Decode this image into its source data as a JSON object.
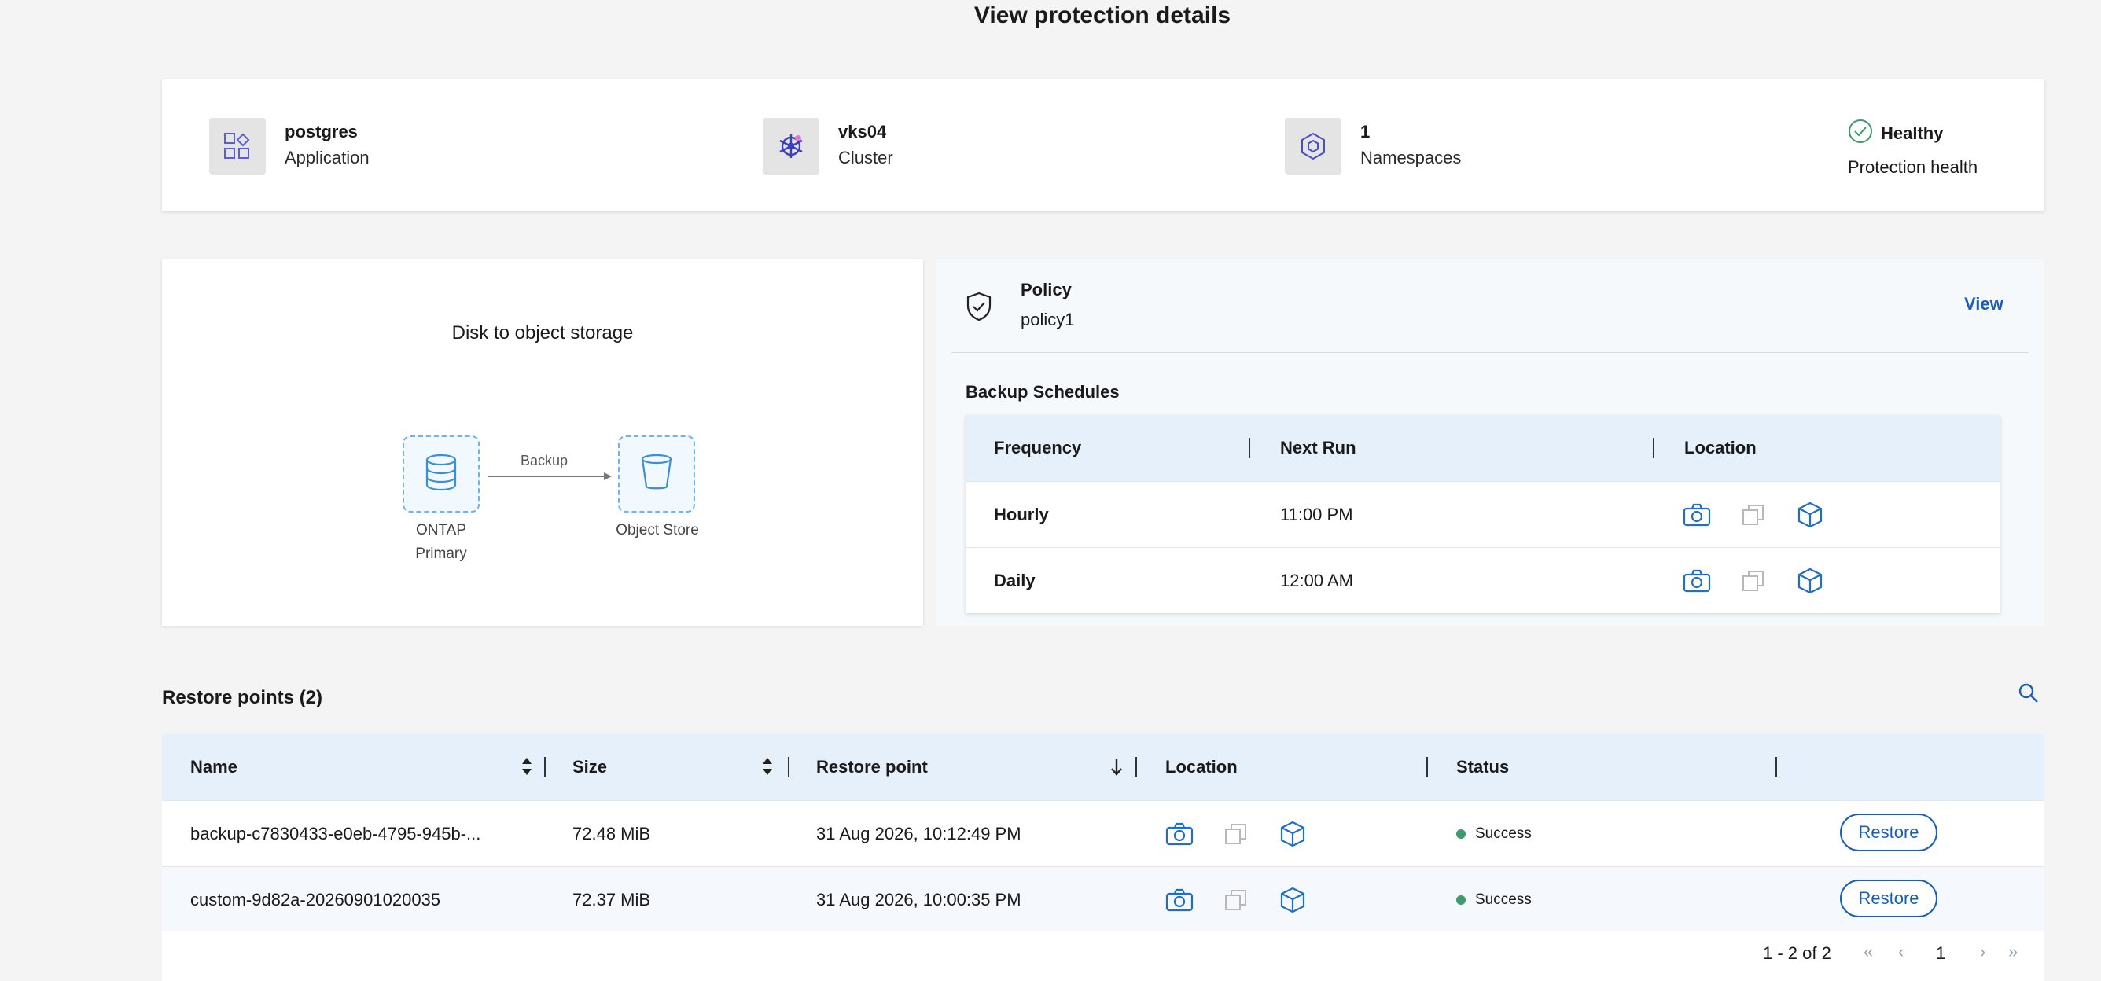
{
  "page": {
    "title": "View protection details"
  },
  "summary": {
    "application": {
      "value": "postgres",
      "label": "Application",
      "icon": "application-icon"
    },
    "cluster": {
      "value": "vks04",
      "label": "Cluster",
      "icon": "kubernetes-icon"
    },
    "namespaces": {
      "value": "1",
      "label": "Namespaces",
      "icon": "namespace-icon"
    },
    "health": {
      "value": "Healthy",
      "label": "Protection health",
      "icon": "check-circle-icon"
    }
  },
  "diagram": {
    "title": "Disk to object storage",
    "source": {
      "label_line1": "ONTAP",
      "label_line2": "Primary",
      "icon": "database-icon"
    },
    "arrow_label": "Backup",
    "target": {
      "label": "Object Store",
      "icon": "bucket-icon"
    }
  },
  "policy": {
    "title": "Policy",
    "name": "policy1",
    "view_label": "View",
    "icon": "shield-check-icon"
  },
  "backup_schedules": {
    "title": "Backup Schedules",
    "columns": [
      "Frequency",
      "Next Run",
      "Location"
    ],
    "rows": [
      {
        "frequency": "Hourly",
        "next_run": "11:00 PM"
      },
      {
        "frequency": "Daily",
        "next_run": "12:00 AM"
      }
    ],
    "location_icons": [
      "camera-icon",
      "copy-icon",
      "cube-icon"
    ]
  },
  "restore_points": {
    "title": "Restore points (2)",
    "columns": [
      "Name",
      "Size",
      "Restore point",
      "Location",
      "Status"
    ],
    "rows": [
      {
        "name": "backup-c7830433-e0eb-4795-945b-...",
        "size": "72.48 MiB",
        "restore_point": "31 Aug 2026, 10:12:49 PM",
        "status": "Success",
        "action": "Restore",
        "more": "···"
      },
      {
        "name": "custom-9d82a-20260901020035",
        "size": "72.37 MiB",
        "restore_point": "31 Aug 2026, 10:00:35 PM",
        "status": "Success",
        "action": "Restore",
        "more": "···"
      }
    ]
  },
  "pagination": {
    "range": "1 - 2 of 2",
    "current_page": "1",
    "first": "«",
    "prev": "‹",
    "next": "›",
    "last": "»"
  },
  "colors": {
    "accent": "#1a5fb4",
    "header_bg": "#e5f0fb",
    "success": "#3d9a6b",
    "icon_blue": "#1f6fc5"
  }
}
